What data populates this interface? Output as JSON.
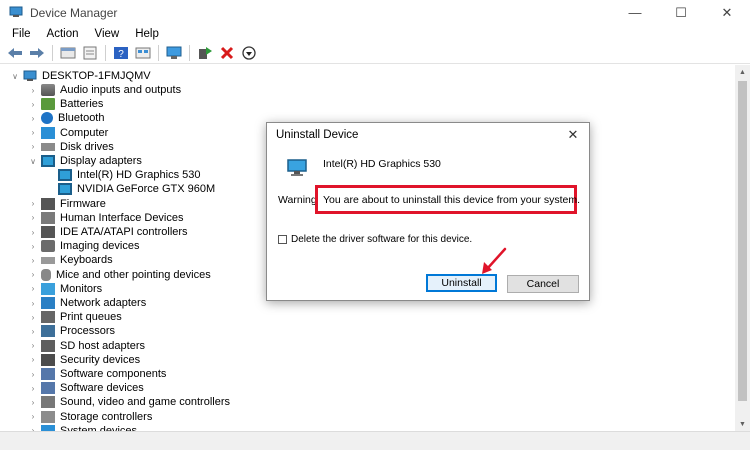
{
  "window": {
    "title": "Device Manager",
    "minimize": "—",
    "maximize": "☐",
    "close": "✕"
  },
  "menu": [
    "File",
    "Action",
    "View",
    "Help"
  ],
  "toolbar": {
    "icons": [
      "back-icon",
      "forward-icon",
      "properties-icon",
      "show-hidden-icon",
      "help-icon",
      "update-driver-icon",
      "scan-hardware-icon",
      "add-driver-icon",
      "uninstall-icon",
      "disable-icon"
    ]
  },
  "tree": {
    "root": "DESKTOP-1FMJQMV",
    "items": [
      {
        "label": "Audio inputs and outputs",
        "icon": "audio"
      },
      {
        "label": "Batteries",
        "icon": "battery"
      },
      {
        "label": "Bluetooth",
        "icon": "bluetooth"
      },
      {
        "label": "Computer",
        "icon": "computer"
      },
      {
        "label": "Disk drives",
        "icon": "disk"
      },
      {
        "label": "Display adapters",
        "icon": "display",
        "expanded": true
      },
      {
        "label": "Intel(R) HD Graphics 530",
        "icon": "display",
        "child": true
      },
      {
        "label": "NVIDIA GeForce GTX 960M",
        "icon": "display",
        "child": true
      },
      {
        "label": "Firmware",
        "icon": "chip"
      },
      {
        "label": "Human Interface Devices",
        "icon": "hid"
      },
      {
        "label": "IDE ATA/ATAPI controllers",
        "icon": "chip"
      },
      {
        "label": "Imaging devices",
        "icon": "dev"
      },
      {
        "label": "Keyboards",
        "icon": "keyboard"
      },
      {
        "label": "Mice and other pointing devices",
        "icon": "mouse"
      },
      {
        "label": "Monitors",
        "icon": "monitor"
      },
      {
        "label": "Network adapters",
        "icon": "network"
      },
      {
        "label": "Print queues",
        "icon": "printer"
      },
      {
        "label": "Processors",
        "icon": "proc"
      },
      {
        "label": "SD host adapters",
        "icon": "sd"
      },
      {
        "label": "Security devices",
        "icon": "sec"
      },
      {
        "label": "Software components",
        "icon": "sw"
      },
      {
        "label": "Software devices",
        "icon": "sw"
      },
      {
        "label": "Sound, video and game controllers",
        "icon": "sound"
      },
      {
        "label": "Storage controllers",
        "icon": "storage"
      },
      {
        "label": "System devices",
        "icon": "sys"
      }
    ]
  },
  "dialog": {
    "title": "Uninstall Device",
    "close": "✕",
    "device_name": "Intel(R) HD Graphics 530",
    "warning_prefix": "Warning:",
    "message": "You are about to uninstall this device from your system.",
    "checkbox_label": "Delete the driver software for this device.",
    "checkbox_checked": false,
    "uninstall_label": "Uninstall",
    "cancel_label": "Cancel"
  },
  "colors": {
    "highlight": "#e0142a",
    "focus": "#0078d7"
  }
}
